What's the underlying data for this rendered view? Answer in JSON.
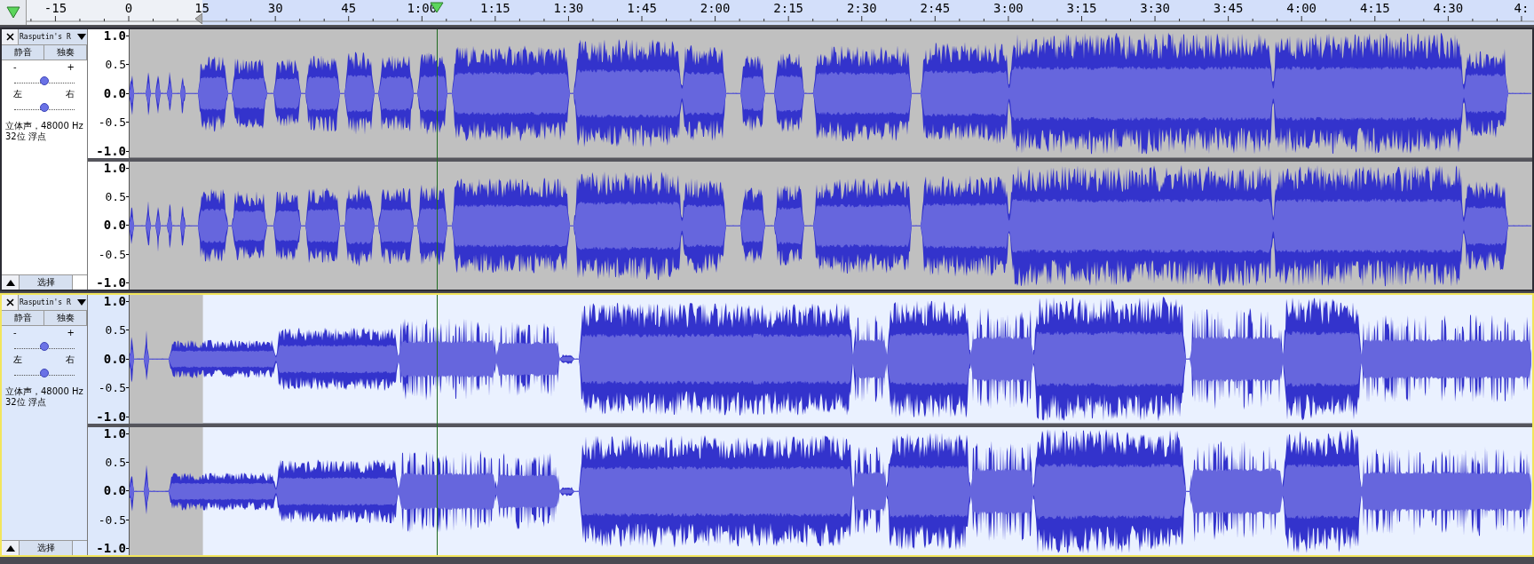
{
  "ruler": {
    "labels": [
      "-15",
      "0",
      "15",
      "30",
      "45",
      "1:00",
      "1:15",
      "1:30",
      "1:45",
      "2:00",
      "2:15",
      "2:30",
      "2:45",
      "3:00",
      "3:15",
      "3:30",
      "3:45",
      "4:00",
      "4:15",
      "4:30",
      "4:"
    ]
  },
  "tracks": [
    {
      "name": "Rasputin's R",
      "selected": false,
      "focused": false,
      "buttons": [
        "静音",
        "独奏"
      ],
      "gain": {
        "minus": "-",
        "plus": "+",
        "level": 0.5
      },
      "pan": {
        "left": "左",
        "right": "右",
        "level": 0.5
      },
      "info": [
        "立体声，48000 Hz",
        "32位 浮点"
      ],
      "select_button": "选择",
      "channels": [
        {
          "scale": [
            "1.0",
            "0.5",
            "0.0",
            "-0.5",
            "-1.0"
          ]
        },
        {
          "scale": [
            "1.0",
            "0.5",
            "0.0",
            "-0.5",
            "-1.0"
          ]
        }
      ]
    },
    {
      "name": "Rasputin's R",
      "selected": true,
      "focused": true,
      "buttons": [
        "静音",
        "独奏"
      ],
      "gain": {
        "minus": "-",
        "plus": "+",
        "level": 0.5
      },
      "pan": {
        "left": "左",
        "right": "右",
        "level": 0.5
      },
      "info": [
        "立体声，48000 Hz",
        "32位 浮点"
      ],
      "select_button": "选择",
      "channels": [
        {
          "scale": [
            "1.0",
            "0.5",
            "0.0",
            "-0.5",
            "-1.0"
          ]
        },
        {
          "scale": [
            "1.0",
            "0.5",
            "0.0",
            "-0.5",
            "-1.0"
          ]
        }
      ]
    }
  ]
}
